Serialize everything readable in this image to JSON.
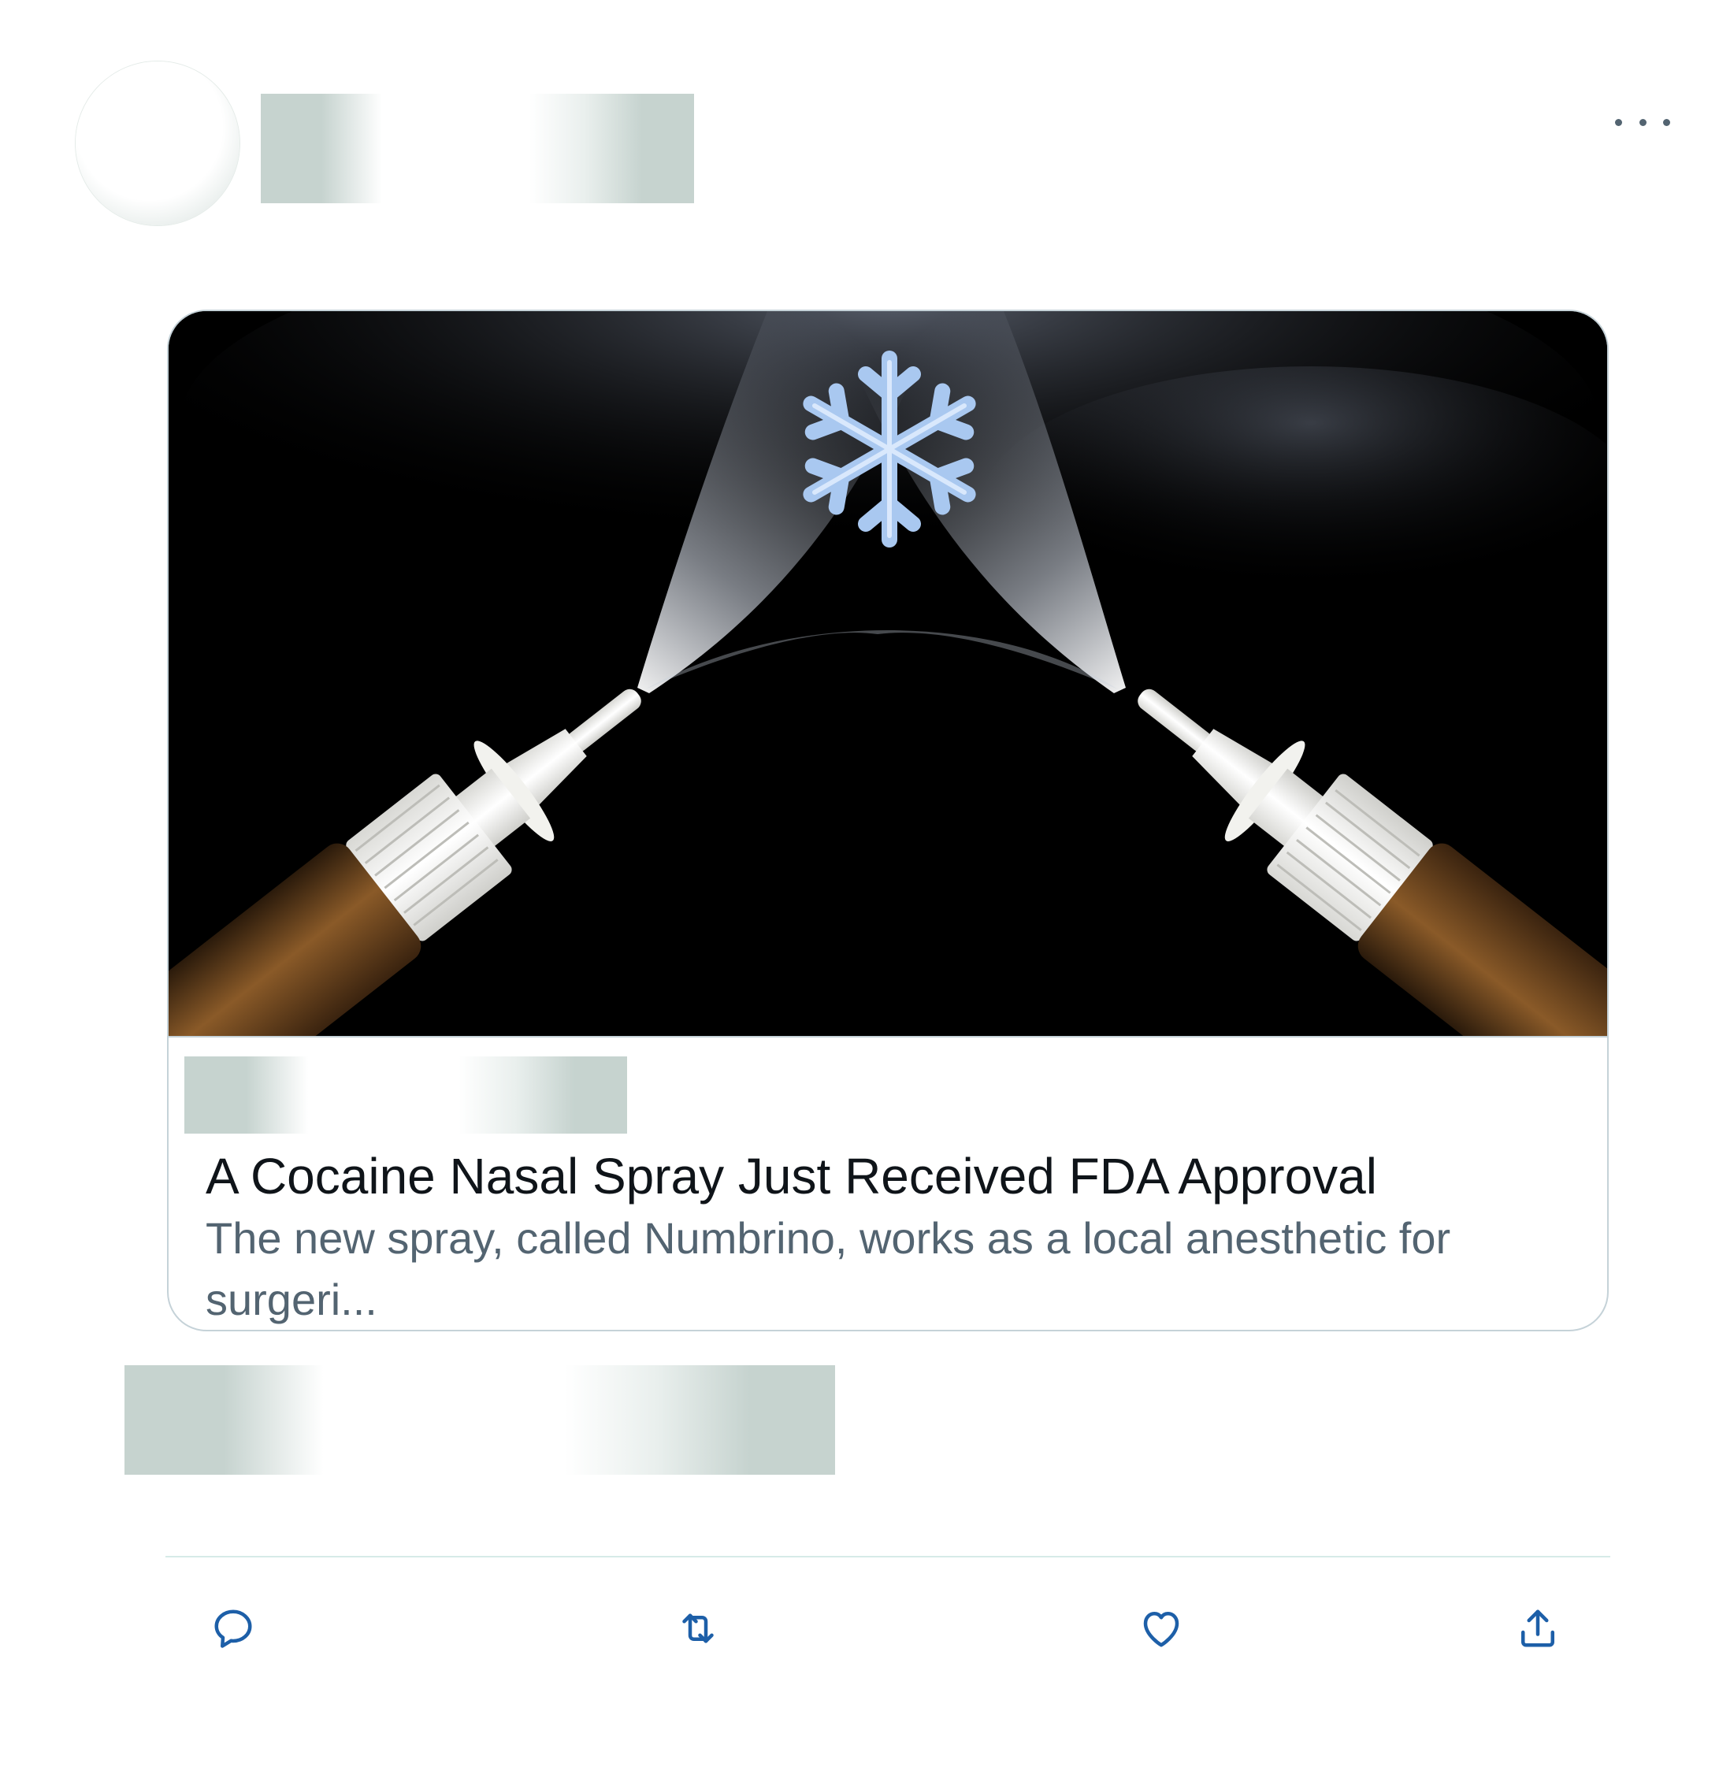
{
  "tweet": {
    "link_card": {
      "title": "A Cocaine Nasal Spray Just Received FDA Approval",
      "description": "The new spray, called Numbrino, works as a local anesthetic for surgeri..."
    },
    "actions": {
      "reply_icon": "speech-bubble",
      "retweet_icon": "two-arrows-loop",
      "like_icon": "heart",
      "share_icon": "upload-arrow"
    }
  },
  "colors": {
    "title_text": "#0f1419",
    "secondary_text": "#536471",
    "action_icon": "#1d5fa8",
    "card_border": "#c5d2d8"
  }
}
